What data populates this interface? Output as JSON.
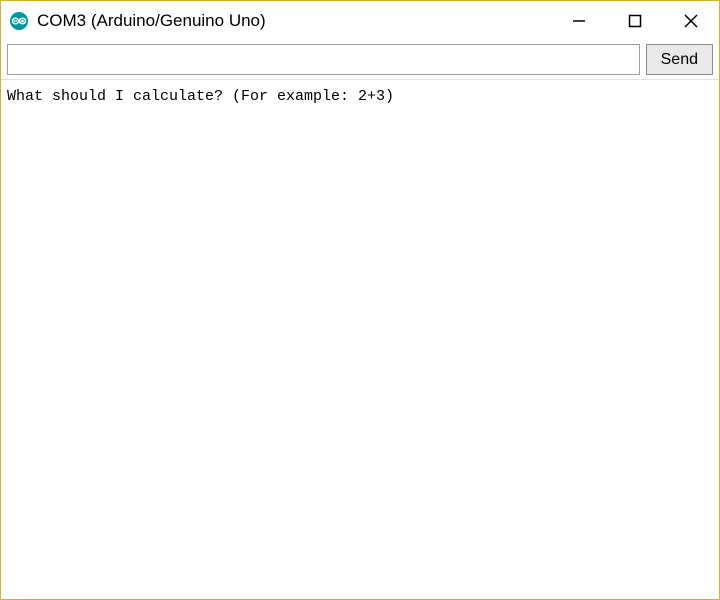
{
  "titlebar": {
    "title": "COM3 (Arduino/Genuino Uno)"
  },
  "toolbar": {
    "input_value": "",
    "input_placeholder": "",
    "send_label": "Send"
  },
  "output": {
    "text": "What should I calculate? (For example: 2+3)"
  },
  "icons": {
    "app": "arduino-icon",
    "minimize": "minimize-icon",
    "maximize": "maximize-icon",
    "close": "close-icon"
  },
  "colors": {
    "arduino_teal": "#00979D",
    "border_gold": "#d4af37"
  }
}
